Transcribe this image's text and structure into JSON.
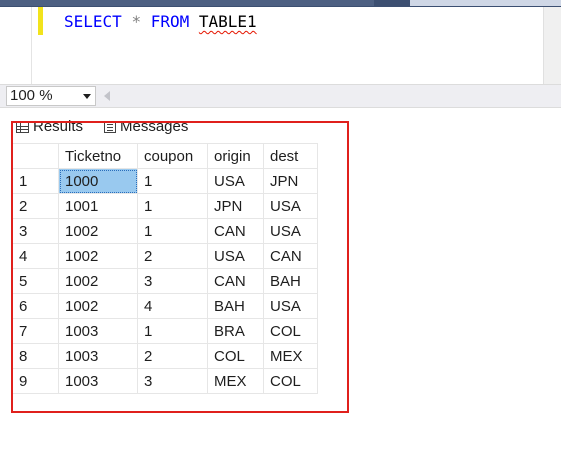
{
  "editor": {
    "keyword_select": "SELECT",
    "star": "*",
    "keyword_from": "FROM",
    "table_name": "TABLE1"
  },
  "zoom": {
    "value": "100 %"
  },
  "tabs": {
    "results": "Results",
    "messages": "Messages"
  },
  "colors": {
    "highlight": "#e0201c",
    "selected_cell": "#99c9ef",
    "keyword": "#0000ff"
  },
  "grid": {
    "columns": [
      "Ticketno",
      "coupon",
      "origin",
      "dest"
    ],
    "rows": [
      {
        "n": "1",
        "ticketno": "1000",
        "coupon": "1",
        "origin": "USA",
        "dest": "JPN"
      },
      {
        "n": "2",
        "ticketno": "1001",
        "coupon": "1",
        "origin": "JPN",
        "dest": "USA"
      },
      {
        "n": "3",
        "ticketno": "1002",
        "coupon": "1",
        "origin": "CAN",
        "dest": "USA"
      },
      {
        "n": "4",
        "ticketno": "1002",
        "coupon": "2",
        "origin": "USA",
        "dest": "CAN"
      },
      {
        "n": "5",
        "ticketno": "1002",
        "coupon": "3",
        "origin": "CAN",
        "dest": "BAH"
      },
      {
        "n": "6",
        "ticketno": "1002",
        "coupon": "4",
        "origin": "BAH",
        "dest": "USA"
      },
      {
        "n": "7",
        "ticketno": "1003",
        "coupon": "1",
        "origin": "BRA",
        "dest": "COL"
      },
      {
        "n": "8",
        "ticketno": "1003",
        "coupon": "2",
        "origin": "COL",
        "dest": "MEX"
      },
      {
        "n": "9",
        "ticketno": "1003",
        "coupon": "3",
        "origin": "MEX",
        "dest": "COL"
      }
    ]
  }
}
